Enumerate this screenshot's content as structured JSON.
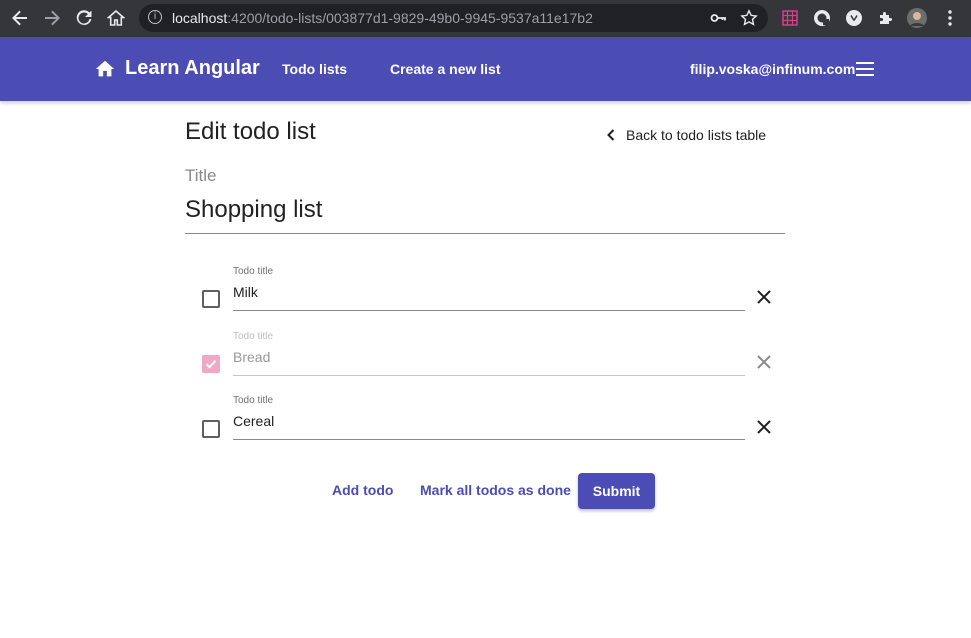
{
  "browser": {
    "url_host": "localhost",
    "url_path": ":4200/todo-lists/003877d1-9829-49b0-9945-9537a11e17b2",
    "icons": [
      "back-arrow-icon",
      "forward-arrow-icon",
      "reload-icon",
      "home-icon",
      "info-icon",
      "key-icon",
      "star-icon",
      "extension-grid-icon",
      "extension-translate-icon",
      "extension-circle-icon",
      "puzzle-icon",
      "avatar",
      "kebab-menu-icon"
    ]
  },
  "toolbar": {
    "brand": "Learn Angular",
    "nav": [
      "Todo lists",
      "Create a new list"
    ],
    "user_email": "filip.voska@infinum.com"
  },
  "page": {
    "title": "Edit todo list",
    "back_link": "Back to todo lists table"
  },
  "form": {
    "title_label": "Title",
    "title_value": "Shopping list",
    "todos": [
      {
        "label": "Todo title",
        "value": "Milk",
        "done": false
      },
      {
        "label": "Todo title",
        "value": "Bread",
        "done": true
      },
      {
        "label": "Todo title",
        "value": "Cereal",
        "done": false
      }
    ]
  },
  "actions": {
    "add_todo": "Add todo",
    "mark_all": "Mark all todos as done",
    "submit": "Submit"
  },
  "colors": {
    "primary": "#4b4cb4",
    "checked_disabled": "#f0a9c4",
    "chrome_bg": "#35363a"
  }
}
